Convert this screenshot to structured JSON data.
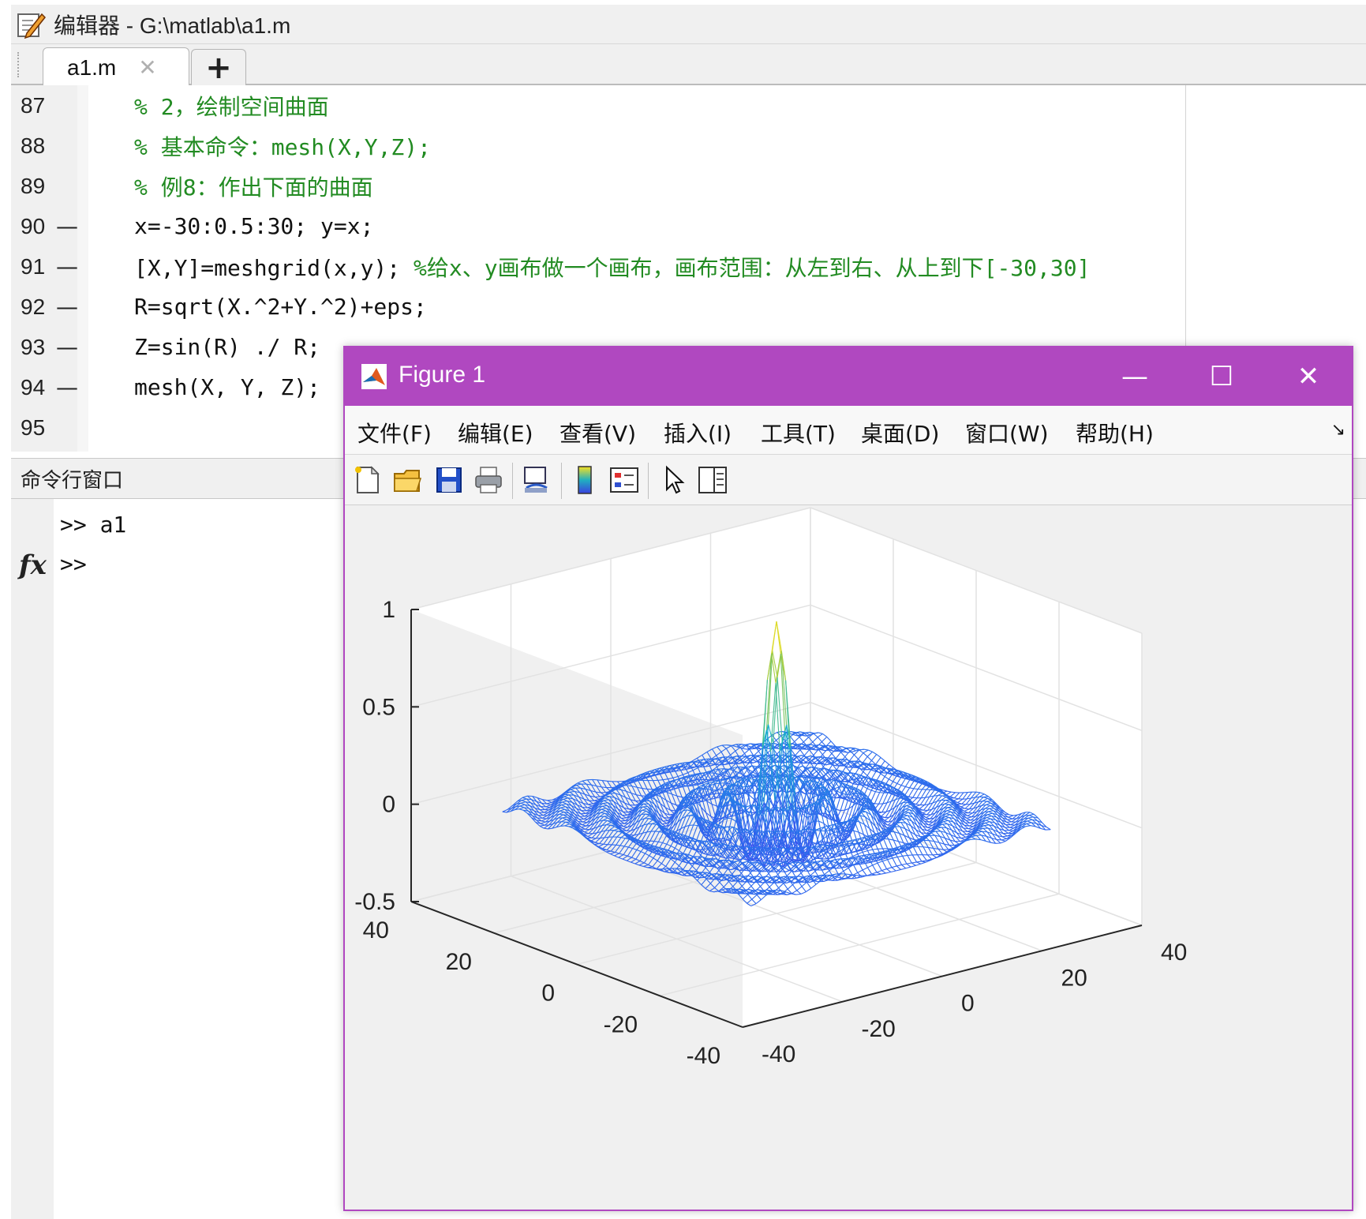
{
  "editor": {
    "title": "编辑器 - G:\\matlab\\a1.m",
    "tab_label": "a1.m",
    "tab_close_glyph": "✕",
    "add_tab_glyph": "+",
    "lines": [
      {
        "num": "87",
        "dash": "",
        "text": "% 2，绘制空间曲面",
        "type": "comment"
      },
      {
        "num": "88",
        "dash": "",
        "text": "% 基本命令：mesh(X,Y,Z);",
        "type": "comment"
      },
      {
        "num": "89",
        "dash": "",
        "text": "% 例8：作出下面的曲面",
        "type": "comment"
      },
      {
        "num": "90",
        "dash": "—",
        "code": "x=-30:0.5:30; y=x;",
        "comment": ""
      },
      {
        "num": "91",
        "dash": "—",
        "code": "[X,Y]=meshgrid(x,y); ",
        "comment": "%给x、y画布做一个画布，画布范围：从左到右、从上到下[-30,30]"
      },
      {
        "num": "92",
        "dash": "—",
        "code": "R=sqrt(X.^2+Y.^2)+eps;",
        "comment": ""
      },
      {
        "num": "93",
        "dash": "—",
        "code": "Z=sin(R) ./ R;",
        "comment": ""
      },
      {
        "num": "94",
        "dash": "—",
        "code": "mesh(X, Y, Z);",
        "comment": ""
      },
      {
        "num": "95",
        "dash": "",
        "code": "",
        "comment": ""
      }
    ]
  },
  "command_window": {
    "title": "命令行窗口",
    "lines": [
      ">> a1",
      ">>"
    ],
    "fx_label": "fx"
  },
  "figure": {
    "title": "Figure 1",
    "minimize_glyph": "—",
    "maximize_glyph": "☐",
    "close_glyph": "✕",
    "menu": [
      "文件(F)",
      "编辑(E)",
      "查看(V)",
      "插入(I)",
      "工具(T)",
      "桌面(D)",
      "窗口(W)",
      "帮助(H)"
    ],
    "dock_glyph": "↘",
    "toolbar": [
      "new-figure",
      "open-file",
      "save-figure",
      "print-figure",
      "link-plot",
      "insert-colorbar",
      "insert-legend",
      "edit-plot",
      "property-inspector"
    ],
    "colors": {
      "title_bar": "#b048c0",
      "mesh_low": "#4a55f0",
      "mesh_mid": "#1fb0c0",
      "mesh_high": "#f8e020"
    }
  },
  "chart_data": {
    "type": "surface-mesh",
    "function": "Z = sin(R)./R, R = sqrt(X.^2+Y.^2)+eps",
    "x_range": [
      -30,
      30
    ],
    "y_range": [
      -30,
      30
    ],
    "x_step": 0.5,
    "peak_z": 1,
    "xlim": [
      -40,
      40
    ],
    "ylim": [
      -40,
      40
    ],
    "zlim": [
      -0.5,
      1
    ],
    "x_ticks": [
      "-40",
      "-20",
      "0",
      "20",
      "40"
    ],
    "y_ticks": [
      "-40",
      "-20",
      "0",
      "20",
      "40"
    ],
    "z_ticks": [
      "-0.5",
      "0",
      "0.5",
      "1"
    ],
    "grid": true,
    "colormap": "parula"
  }
}
